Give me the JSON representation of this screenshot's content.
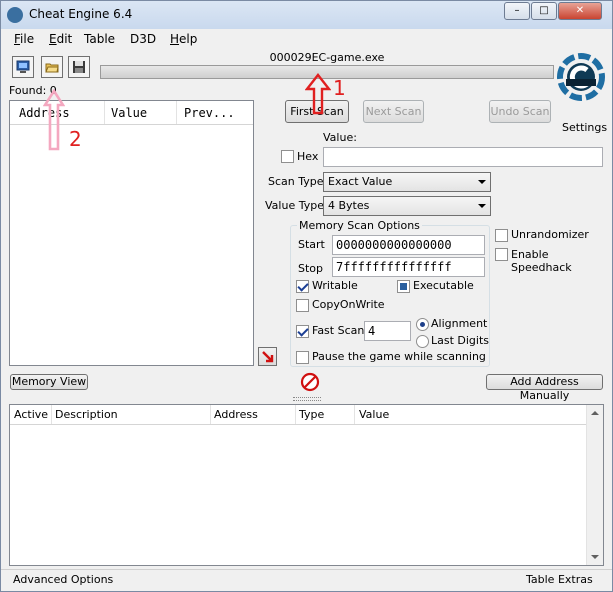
{
  "window": {
    "title": "Cheat Engine 6.4",
    "minimize": "–",
    "maximize": "□",
    "close": "✕"
  },
  "menu": [
    {
      "ul": "F",
      "rest": "ile"
    },
    {
      "ul": "E",
      "rest": "dit"
    },
    {
      "ul": "",
      "rest": "Table"
    },
    {
      "ul": "",
      "rest": "D3D"
    },
    {
      "ul": "H",
      "rest": "elp"
    }
  ],
  "toolbar": {
    "process_name": "000029EC-game.exe",
    "found_label": "Found: 0",
    "settings_label": "Settings"
  },
  "results_list": {
    "headers": [
      "Address",
      "Value",
      "Prev..."
    ]
  },
  "scan": {
    "first_scan": "First Scan",
    "next_scan": "Next Scan",
    "undo_scan": "Undo Scan",
    "value_label": "Value:",
    "hex_label": "Hex",
    "value_input": "",
    "scan_type_label": "Scan Type",
    "scan_type_value": "Exact Value",
    "value_type_label": "Value Type",
    "value_type_value": "4 Bytes"
  },
  "memory_options": {
    "title": "Memory Scan Options",
    "start_label": "Start",
    "start_value": "0000000000000000",
    "stop_label": "Stop",
    "stop_value": "7fffffffffffffff",
    "writable": "Writable",
    "executable": "Executable",
    "copy_on_write": "CopyOnWrite",
    "fast_scan": "Fast Scan",
    "fast_scan_value": "4",
    "alignment": "Alignment",
    "last_digits": "Last Digits",
    "pause_game": "Pause the game while scanning"
  },
  "extra_options": {
    "unrandomizer": "Unrandomizer",
    "speedhack": "Enable Speedhack"
  },
  "bottom_buttons": {
    "memory_view": "Memory View",
    "add_address": "Add Address Manually"
  },
  "address_list": {
    "headers": [
      "Active",
      "Description",
      "Address",
      "Type",
      "Value"
    ]
  },
  "status": {
    "advanced": "Advanced Options",
    "table_extras": "Table Extras"
  },
  "annotations": {
    "one": "1",
    "two": "2"
  },
  "colors": {
    "annotation_red": "#e02020",
    "annotation_pink": "#f4a8c0"
  }
}
